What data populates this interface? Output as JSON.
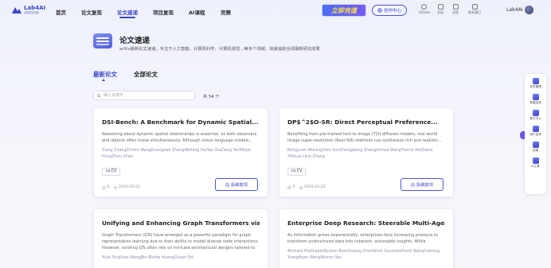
{
  "brand": {
    "name": "Lab4AI",
    "tagline": "大模型实验室"
  },
  "nav": {
    "items": [
      "首页",
      "论文复现",
      "论文速递",
      "项目复现",
      "AI课程",
      "竞赛"
    ],
    "active_index": 2
  },
  "promo": {
    "label": "立即充值"
  },
  "creator": {
    "label": "创作中心"
  },
  "tools": [
    "GitHub",
    "文档",
    "消息",
    "联系我们"
  ],
  "user": {
    "name": "Lab4AI"
  },
  "hero": {
    "title": "论文速递",
    "description": "arXiv最新论文速递，专注于人工智能、计算机科学、计算机视觉...等多个领域，快速追踪全球最新研究成果"
  },
  "tabs": {
    "items": [
      "最新论文",
      "全部论文"
    ],
    "active_index": 0
  },
  "search": {
    "placeholder": "输入关键字",
    "count_label": "共 54 个"
  },
  "cards": [
    {
      "title": "DSI-Bench: A Benchmark for Dynamic Spatial...",
      "abstract": "Reasoning about dynamic spatial relationships is essential, as both observers and objects often move simultaneously. Although vision-language models...",
      "authors": "Ziang ZhangZichen WangGuanghao ZhangWeilong DaiYan XiaZiang YanMinjie HongZhou Zhao",
      "tag": "cs.CV",
      "views": "0",
      "date": "2025-10-22",
      "button": "投稿复现"
    },
    {
      "title": "DP$^2$O-SR: Direct Perceptual Preference...",
      "abstract": "Benefiting from pre-trained text-to-image (T2I) diffusion models, real-world image super-resolution (Real-ISR) methods can synthesize rich and realistic...",
      "authors": "Rongyuan WuLingchen SunZhengqiang ZhangShihao WangTianhe WuQiaosi YiShuai LiLei Zhang",
      "tag": "cs.CV",
      "views": "0",
      "date": "2025-10-22",
      "button": "投稿复现"
    },
    {
      "title": "Unifying and Enhancing Graph Transformers via a...",
      "abstract": "Graph Transformers (GTs) have emerged as a powerful paradigm for graph representation learning due to their ability to model diverse node interactions. However, existing GTs often rely on intricate architectural designs tailored to",
      "authors": "Yujie XingXiao WangBin WuHai HuangChuan Shi",
      "tag": "",
      "views": "",
      "date": "",
      "button": ""
    },
    {
      "title": "Enterprise Deep Research: Steerable Multi-Agent...",
      "abstract": "As information grows exponentially, enterprises face increasing pressure to transform unstructured data into coherent, actionable insights. While",
      "authors": "Akshara PrabhakarRoshan RamZixiang ChenSilvio SavareseFrank WangCaiming XiongHuan WangWeiran Yao",
      "tag": "",
      "views": "",
      "date": "",
      "button": ""
    }
  ],
  "sidebar": {
    "items": [
      "文件管理",
      "数据实验",
      "算力中心",
      "用户反馈",
      "资源",
      "AI工具"
    ]
  },
  "colors": {
    "accent": "#3b46c9",
    "promo_gradient_start": "#4c6df0",
    "promo_text": "#ffe24a"
  }
}
